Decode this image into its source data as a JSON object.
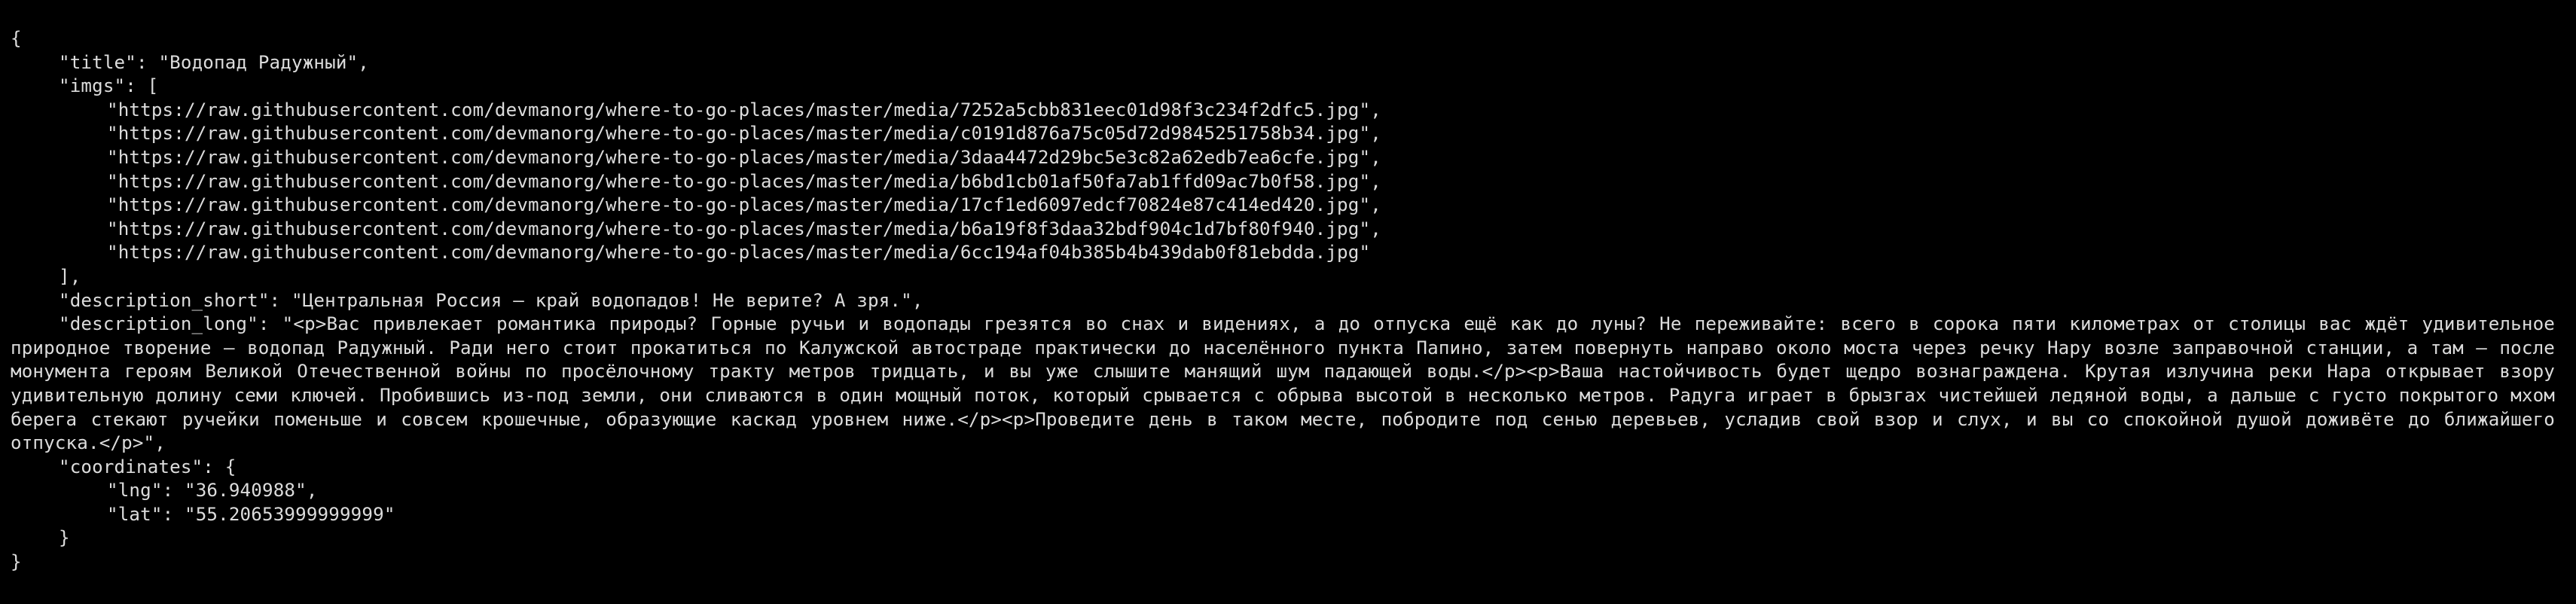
{
  "json": {
    "title_key": "\"title\"",
    "title_value": "\"Водопад Радужный\"",
    "imgs_key": "\"imgs\"",
    "imgs": [
      "\"https://raw.githubusercontent.com/devmanorg/where-to-go-places/master/media/7252a5cbb831eec01d98f3c234f2dfc5.jpg\"",
      "\"https://raw.githubusercontent.com/devmanorg/where-to-go-places/master/media/c0191d876a75c05d72d9845251758b34.jpg\"",
      "\"https://raw.githubusercontent.com/devmanorg/where-to-go-places/master/media/3daa4472d29bc5e3c82a62edb7ea6cfe.jpg\"",
      "\"https://raw.githubusercontent.com/devmanorg/where-to-go-places/master/media/b6bd1cb01af50fa7ab1ffd09ac7b0f58.jpg\"",
      "\"https://raw.githubusercontent.com/devmanorg/where-to-go-places/master/media/17cf1ed6097edcf70824e87c414ed420.jpg\"",
      "\"https://raw.githubusercontent.com/devmanorg/where-to-go-places/master/media/b6a19f8f3daa32bdf904c1d7bf80f940.jpg\"",
      "\"https://raw.githubusercontent.com/devmanorg/where-to-go-places/master/media/6cc194af04b385b4b439dab0f81ebdda.jpg\""
    ],
    "description_short_key": "\"description_short\"",
    "description_short_value": "\"Центральная Россия — край водопадов! Не верите? А зря.\"",
    "description_long_key": "\"description_long\"",
    "description_long_value": "\"<p>Вас привлекает романтика природы? Горные ручьи и водопады грезятся во снах и видениях, а до отпуска ещё как до луны? Не переживайте: всего в сорока пяти километрах от столицы вас ждёт удивительное природное творение — водопад Радужный. Ради него стоит прокатиться по Калужской автостраде практически до населённого пункта Папино, затем повернуть направо около моста через речку Нару возле заправочной станции, а там — после монумента героям Великой Отечественной войны по просёлочному тракту метров тридцать, и вы уже слышите манящий шум падающей воды.</p><p>Ваша настойчивость будет щедро вознаграждена. Крутая излучина реки Нара открывает взору удивительную долину семи ключей. Пробившись из-под земли, они сливаются в один мощный поток, который срывается с обрыва высотой в несколько метров. Радуга играет в брызгах чистейшей ледяной воды, а дальше с густо покрытого мхом берега стекают ручейки поменьше и совсем крошечные, образующие каскад уровнем ниже.</p><p>Проведите день в таком месте, побродите под сенью деревьев, усладив свой взор и слух, и вы со спокойной душой доживёте до ближайшего отпуска.</p>\"",
    "coordinates_key": "\"coordinates\"",
    "lng_key": "\"lng\"",
    "lng_value": "\"36.940988\"",
    "lat_key": "\"lat\"",
    "lat_value": "\"55.20653999999999\""
  },
  "punct": {
    "open_brace": "{",
    "close_brace": "}",
    "open_bracket": "[",
    "close_bracket_comma": "],",
    "colon": ": ",
    "comma": ",",
    "open_obj": "{",
    "close_obj": "}"
  },
  "colors": {
    "background": "#000000",
    "text": "#dcdcdc"
  }
}
